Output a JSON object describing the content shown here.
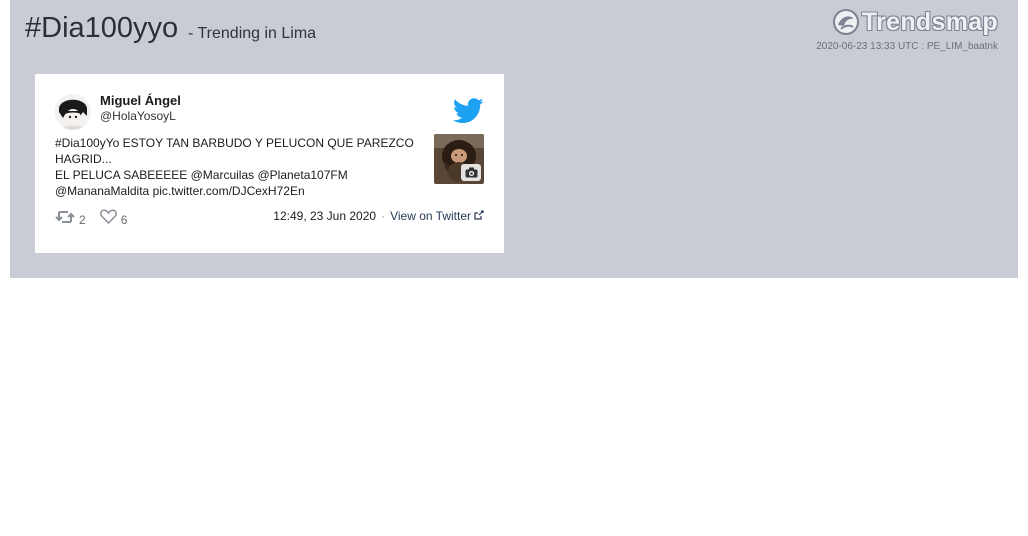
{
  "header": {
    "hashtag": "#Dia100yyo",
    "subtitle": "- Trending in Lima",
    "brand": "Trendsmap",
    "stamp": "2020-06-23 13:33 UTC : PE_LIM_baatnk"
  },
  "tweet": {
    "user_name": "Miguel Ángel",
    "user_handle": "@HolaYosoyL",
    "text_lines": [
      "#Dia100yYo ESTOY TAN BARBUDO Y PELUCON QUE PAREZCO",
      "HAGRID...",
      "EL PELUCA SABEEEEE @Marcuilas @Planeta107FM",
      "@MananaMaldita pic.twitter.com/DJCexH72En"
    ],
    "retweet_count": "2",
    "like_count": "6",
    "timestamp": "12:49, 23 Jun 2020",
    "separator": "·",
    "view_link": "View on Twitter"
  },
  "colors": {
    "panel_bg": "#c9ccd4",
    "twitter_blue": "#1da1f2"
  },
  "icons": {
    "logo": "trendsmap-logo-icon",
    "bird": "twitter-bird-icon",
    "retweet": "retweet-icon",
    "like": "heart-icon",
    "external": "external-link-icon",
    "camera": "camera-icon"
  }
}
